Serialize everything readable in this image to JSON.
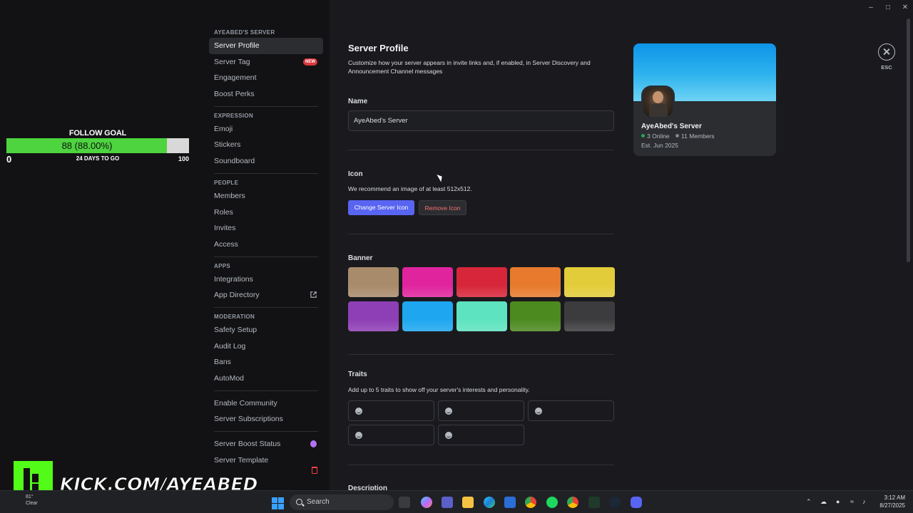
{
  "follow_goal": {
    "title": "FOLLOW GOAL",
    "value_text": "88 (88.00%)",
    "progress_fraction": 0.88,
    "min": "0",
    "days_left": "24 DAYS TO GO",
    "max": "100"
  },
  "sidebar": {
    "server_section": "AYEABED'S SERVER",
    "server_items": [
      {
        "label": "Server Profile"
      },
      {
        "label": "Server Tag",
        "badge": "NEW"
      },
      {
        "label": "Engagement"
      },
      {
        "label": "Boost Perks"
      }
    ],
    "expression_section": "EXPRESSION",
    "expression_items": [
      {
        "label": "Emoji"
      },
      {
        "label": "Stickers"
      },
      {
        "label": "Soundboard"
      }
    ],
    "people_section": "PEOPLE",
    "people_items": [
      {
        "label": "Members"
      },
      {
        "label": "Roles"
      },
      {
        "label": "Invites"
      },
      {
        "label": "Access"
      }
    ],
    "apps_section": "APPS",
    "apps_items": [
      {
        "label": "Integrations"
      },
      {
        "label": "App Directory"
      }
    ],
    "moderation_section": "MODERATION",
    "moderation_items": [
      {
        "label": "Safety Setup"
      },
      {
        "label": "Audit Log"
      },
      {
        "label": "Bans"
      },
      {
        "label": "AutoMod"
      }
    ],
    "misc_items": [
      {
        "label": "Enable Community"
      },
      {
        "label": "Server Subscriptions"
      }
    ],
    "status_items": [
      {
        "label": "Server Boost Status"
      },
      {
        "label": "Server Template"
      }
    ]
  },
  "main": {
    "title": "Server Profile",
    "description": "Customize how your server appears in invite links and, if enabled, in Server Discovery and Announcement Channel messages",
    "name_label": "Name",
    "name_value": "AyeAbed's Server",
    "icon_label": "Icon",
    "icon_hint": "We recommend an image of at least 512x512.",
    "change_icon_label": "Change Server Icon",
    "remove_icon_label": "Remove Icon",
    "banner_label": "Banner",
    "banner_colors": [
      "#a88b6a",
      "#e0249e",
      "#d7263a",
      "#e77a2d",
      "#e3cc3a",
      "#8e3fb5",
      "#1ea7f0",
      "#5ee3c0",
      "#4c8a20",
      "#3c3c3e"
    ],
    "selected_banner": 6,
    "traits_label": "Traits",
    "traits_hint": "Add up to 5 traits to show off your server's interests and personality.",
    "description_label": "Description"
  },
  "preview": {
    "server_name": "AyeAbed's Server",
    "online": "3 Online",
    "members": "11 Members",
    "established": "Est. Jun 2025",
    "online_color": "#23a55a",
    "members_color": "#80848e"
  },
  "close_label": "ESC",
  "overlay": {
    "kick_url": "KICK.COM/AYEABED"
  },
  "taskbar": {
    "weather_temp": "81°",
    "weather_desc": "Clear",
    "search_placeholder": "Search",
    "time": "3:12 AM",
    "date": "8/27/2025"
  }
}
